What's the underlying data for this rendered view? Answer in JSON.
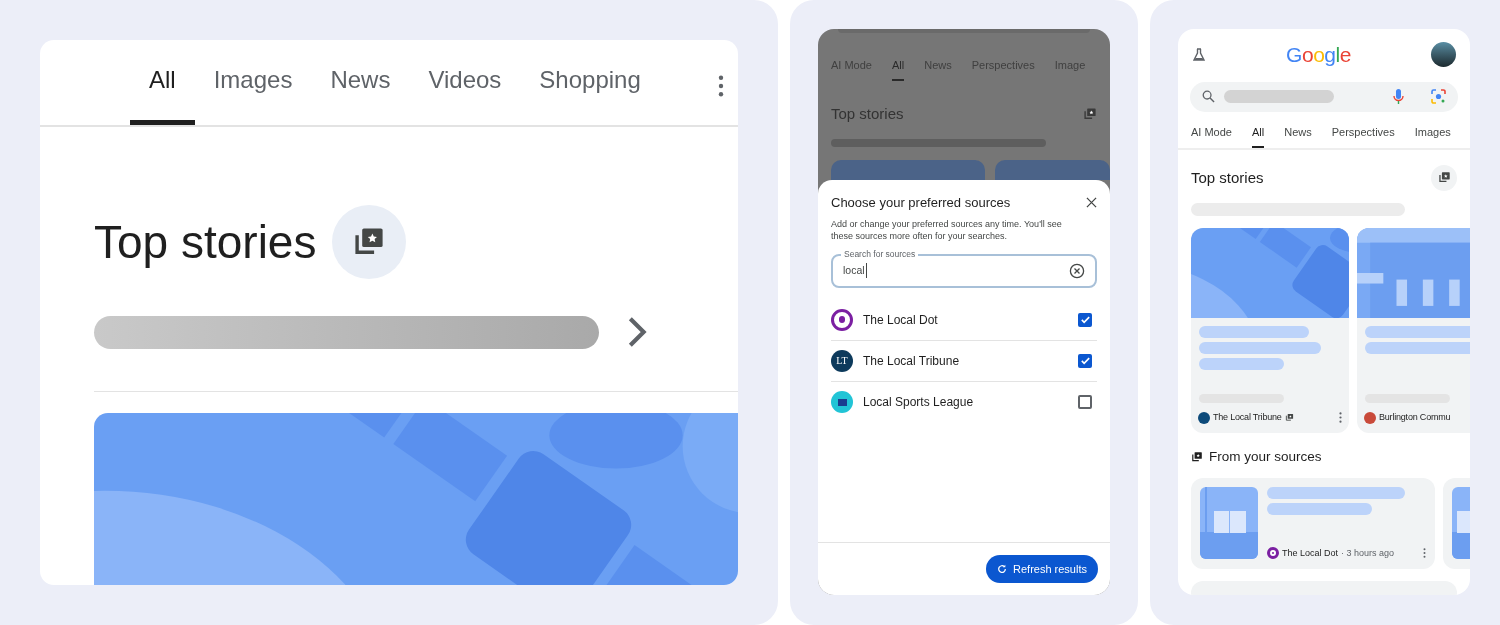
{
  "desktop": {
    "tabs": [
      {
        "label": "All",
        "selected": true
      },
      {
        "label": "Images",
        "selected": false
      },
      {
        "label": "News",
        "selected": false
      },
      {
        "label": "Videos",
        "selected": false
      },
      {
        "label": "Shopping",
        "selected": false
      }
    ],
    "section_title": "Top stories"
  },
  "sheet_view": {
    "background": {
      "tabs": [
        {
          "label": "AI Mode",
          "selected": false
        },
        {
          "label": "All",
          "selected": true
        },
        {
          "label": "News",
          "selected": false
        },
        {
          "label": "Perspectives",
          "selected": false
        },
        {
          "label": "Image",
          "selected": false
        }
      ],
      "section_title": "Top stories"
    },
    "dialog": {
      "title": "Choose your preferred sources",
      "description": "Add or change your preferred sources any time. You'll see these sources more often for your searches.",
      "search": {
        "label": "Search for sources",
        "value": "local"
      },
      "sources": [
        {
          "name": "The Local Dot",
          "checked": true,
          "logo": {
            "kind": "dot"
          }
        },
        {
          "name": "The Local Tribune",
          "checked": true,
          "logo": {
            "kind": "monogram",
            "text": "LT"
          }
        },
        {
          "name": "Local Sports League",
          "checked": false,
          "logo": {
            "kind": "flag"
          }
        }
      ],
      "button": "Refresh results"
    }
  },
  "mobile": {
    "logo": "Google",
    "tabs": [
      {
        "label": "AI Mode",
        "selected": false
      },
      {
        "label": "All",
        "selected": true
      },
      {
        "label": "News",
        "selected": false
      },
      {
        "label": "Perspectives",
        "selected": false
      },
      {
        "label": "Images",
        "selected": false
      }
    ],
    "section_title": "Top stories",
    "stories": [
      {
        "source": "The Local Tribune",
        "preferred": true,
        "color": "#0d4a7a"
      },
      {
        "source": "Burlington Commu",
        "preferred": false,
        "color": "#c94a3a"
      }
    ],
    "from_sources": {
      "title": "From your sources",
      "items": [
        {
          "source": "The Local Dot",
          "time": "· 3 hours ago"
        }
      ]
    }
  }
}
